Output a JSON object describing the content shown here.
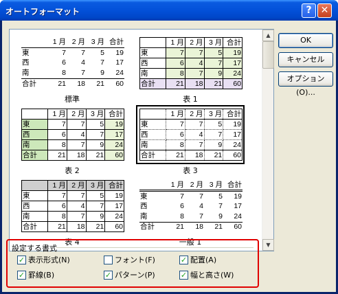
{
  "window": {
    "title": "オートフォーマット",
    "help_glyph": "?",
    "close_glyph": "✕"
  },
  "table_sample": {
    "header": [
      "",
      "1 月",
      "2 月",
      "3 月",
      "合計"
    ],
    "rows": [
      [
        "東",
        "7",
        "7",
        "5",
        "19"
      ],
      [
        "西",
        "6",
        "4",
        "7",
        "17"
      ],
      [
        "南",
        "8",
        "7",
        "9",
        "24"
      ],
      [
        "合計",
        "21",
        "18",
        "21",
        "60"
      ]
    ]
  },
  "samples": [
    {
      "caption": "標準"
    },
    {
      "caption": "表 1"
    },
    {
      "caption": "表 2"
    },
    {
      "caption": "表 3"
    },
    {
      "caption": "表 4"
    },
    {
      "caption": "一般 1"
    }
  ],
  "buttons": {
    "ok": "OK",
    "cancel": "キャンセル",
    "options": "オプション(O)..."
  },
  "apply": {
    "title": "設定する書式",
    "items": [
      {
        "label": "表示形式(N)",
        "checked": true
      },
      {
        "label": "フォント(F)",
        "checked": false
      },
      {
        "label": "配置(A)",
        "checked": true
      },
      {
        "label": "罫線(B)",
        "checked": true
      },
      {
        "label": "パターン(P)",
        "checked": true
      },
      {
        "label": "幅と高さ(W)",
        "checked": true
      }
    ]
  },
  "scrollbar": {
    "up_glyph": "▲",
    "down_glyph": "▼"
  },
  "colors": {
    "titlebar": "#0351d9",
    "highlight_group": "#e00000",
    "selected_border": "#000000"
  }
}
